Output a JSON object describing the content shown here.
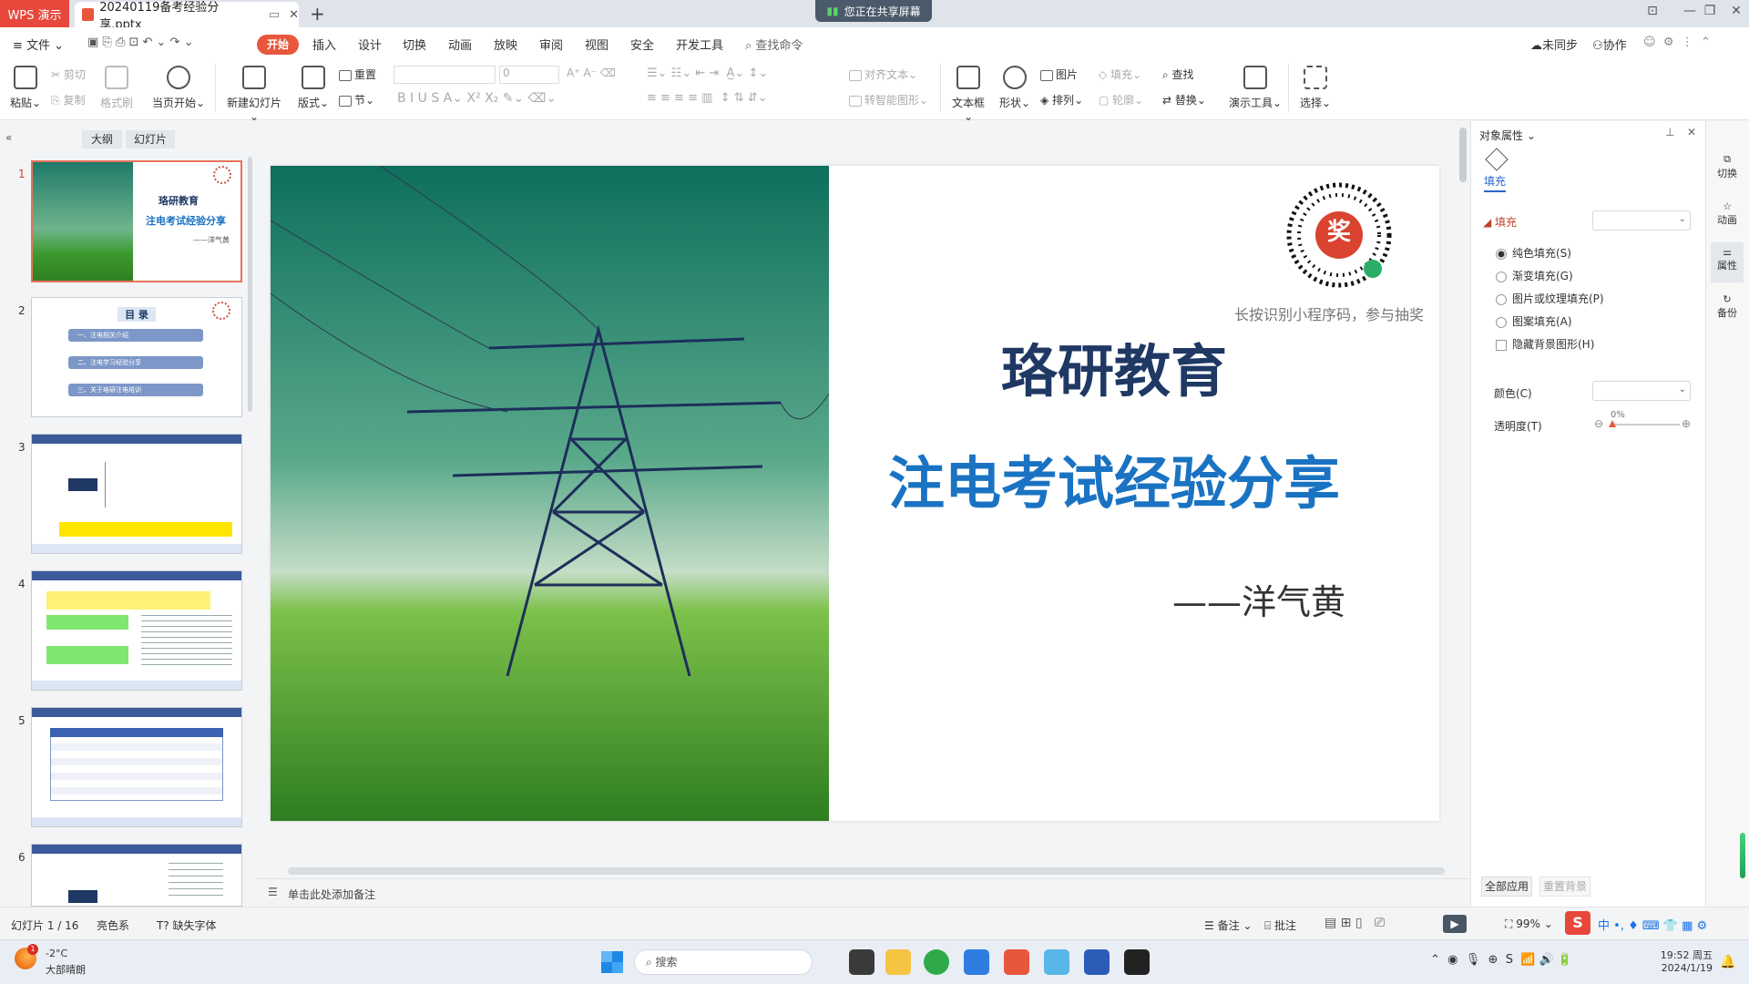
{
  "titlebar": {
    "app_tab": "WPS 演示",
    "doc_tab": "20240119备考经验分享.pptx",
    "new_tab": "+",
    "share_notice": "您正在共享屏幕"
  },
  "menubar": {
    "file": "文件",
    "items": [
      "开始",
      "插入",
      "设计",
      "切换",
      "动画",
      "放映",
      "审阅",
      "视图",
      "安全",
      "开发工具"
    ],
    "search_placeholder": "查找命令",
    "unsync": "未同步",
    "collab": "协作"
  },
  "ribbon": {
    "paste": "粘贴",
    "cut": "剪切",
    "copy": "复制",
    "format_painter": "格式刷",
    "from_start": "当页开始",
    "new_slide": "新建幻灯片",
    "layout": "版式",
    "reset": "重置",
    "section": "节",
    "font_size": "0",
    "align_text": "对齐文本",
    "smart_art": "转智能图形",
    "textbox": "文本框",
    "shape": "形状",
    "picture": "图片",
    "arrange": "排列",
    "fill": "填充",
    "outline": "轮廓",
    "find": "查找",
    "replace": "替换",
    "presenter_tools": "演示工具",
    "select": "选择"
  },
  "leftpanel": {
    "tab_outline": "大纲",
    "tab_slides": "幻灯片",
    "thumbs": [
      {
        "num": "1",
        "title": "珞研教育",
        "subtitle": "注电考试经验分享",
        "author": "——洋气黄"
      },
      {
        "num": "2",
        "title": "目 录",
        "items": [
          "一、注电相关介绍",
          "二、注电学习经验分享",
          "三、关于珞研注电培训"
        ]
      },
      {
        "num": "3"
      },
      {
        "num": "4"
      },
      {
        "num": "5"
      },
      {
        "num": "6"
      }
    ]
  },
  "slide": {
    "qr_caption": "长按识别小程序码，参与抽奖",
    "qr_center": "奖",
    "title": "珞研教育",
    "subtitle": "注电考试经验分享",
    "author": "——洋气黄"
  },
  "notes_placeholder": "单击此处添加备注",
  "rightpanel": {
    "header": "对象属性",
    "tab_fill": "填充",
    "section_fill": "填充",
    "options": [
      "纯色填充(S)",
      "渐变填充(G)",
      "图片或纹理填充(P)",
      "图案填充(A)"
    ],
    "hide_bg": "隐藏背景图形(H)",
    "color_label": "颜色(C)",
    "transparency_label": "透明度(T)",
    "transparency_value": "0%",
    "apply_all": "全部应用",
    "reset_bg": "重置背景"
  },
  "rightrail": [
    "切换",
    "动画",
    "属性",
    "备份"
  ],
  "statusbar": {
    "slide_count": "幻灯片 1 / 16",
    "theme": "亮色系",
    "missing_font": "缺失字体",
    "notes": "备注",
    "comments": "批注",
    "zoom": "99%"
  },
  "taskbar": {
    "temp": "-2°C",
    "weather": "大部晴朗",
    "search": "搜索",
    "time": "19:52 周五",
    "date": "2024/1/19",
    "ime": "中"
  },
  "colors": {
    "accent": "#e8573c",
    "slide_title": "#1f3864",
    "slide_subtitle": "#1a73c2"
  }
}
